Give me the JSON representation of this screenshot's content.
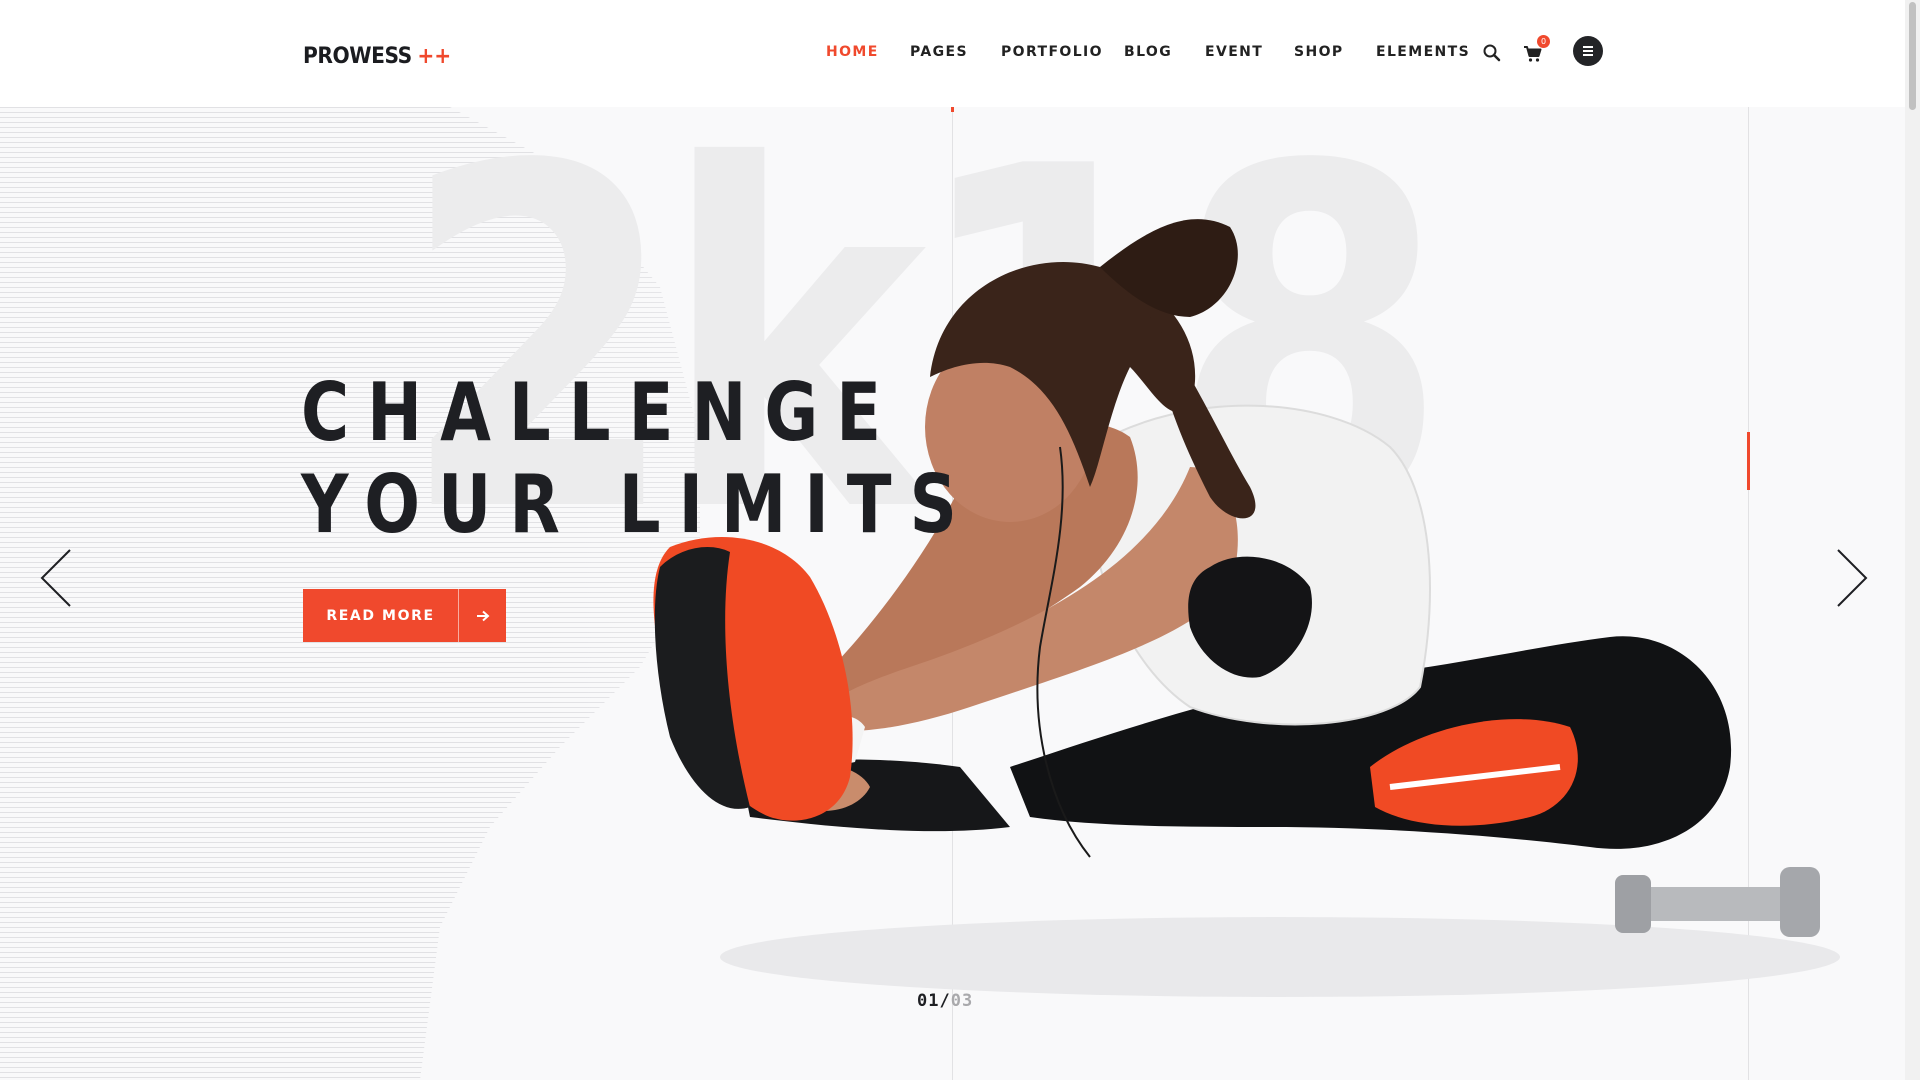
{
  "brand": {
    "name": "PROWESS",
    "mark": "++",
    "accent_color": "#f0492d",
    "dark_color": "#1e1f23"
  },
  "nav": {
    "items": [
      {
        "label": "HOME",
        "active": true
      },
      {
        "label": "PAGES",
        "active": false
      },
      {
        "label": "PORTFOLIO",
        "active": false
      },
      {
        "label": "BLOG",
        "active": false
      },
      {
        "label": "EVENT",
        "active": false
      },
      {
        "label": "SHOP",
        "active": false
      },
      {
        "label": "ELEMENTS",
        "active": false
      }
    ],
    "search_icon": "search-icon",
    "cart_icon": "cart-icon",
    "cart_count": "0",
    "menu_icon": "hamburger-menu-icon"
  },
  "hero": {
    "watermark": "2k18",
    "headline_line1": "CHALLENGE",
    "headline_line2": "YOUR LIMITS",
    "cta_label": "READ MORE",
    "cta_icon": "arrow-right-icon",
    "prev_icon": "chevron-left-icon",
    "next_icon": "chevron-right-icon",
    "slide_current": "01",
    "slide_separator": "/",
    "slide_total": "03"
  }
}
